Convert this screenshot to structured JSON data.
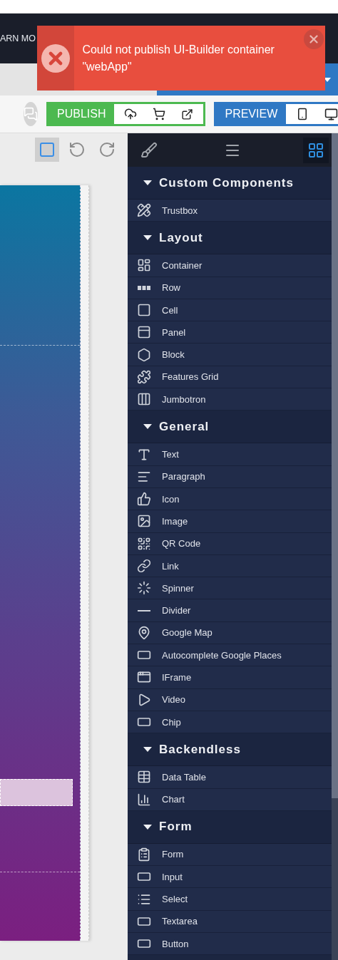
{
  "header": {
    "credits_link": "ARN MO"
  },
  "toast": {
    "message": "Could not publish UI-Builder container \"webApp\""
  },
  "toolbar": {
    "publish": "PUBLISH",
    "preview": "PREVIEW"
  },
  "canvas_tools": [
    {
      "kind": "select",
      "selected": true
    },
    {
      "kind": "undo",
      "selected": false
    },
    {
      "kind": "redo",
      "selected": false
    }
  ],
  "panel_tabs": [
    {
      "kind": "styles",
      "selected": false
    },
    {
      "kind": "layers",
      "selected": false
    },
    {
      "kind": "components",
      "selected": true
    }
  ],
  "sections": [
    {
      "title": "Custom Components",
      "expanded": true,
      "items": [
        {
          "label": "Trustbox"
        }
      ]
    },
    {
      "title": "Layout",
      "expanded": true,
      "items": [
        {
          "label": "Container"
        },
        {
          "label": "Row"
        },
        {
          "label": "Cell"
        },
        {
          "label": "Panel"
        },
        {
          "label": "Block"
        },
        {
          "label": "Features Grid"
        },
        {
          "label": "Jumbotron"
        }
      ]
    },
    {
      "title": "General",
      "expanded": true,
      "items": [
        {
          "label": "Text"
        },
        {
          "label": "Paragraph"
        },
        {
          "label": "Icon"
        },
        {
          "label": "Image"
        },
        {
          "label": "QR Code"
        },
        {
          "label": "Link"
        },
        {
          "label": "Spinner"
        },
        {
          "label": "Divider"
        },
        {
          "label": "Google Map"
        },
        {
          "label": "Autocomplete Google Places"
        },
        {
          "label": "IFrame"
        },
        {
          "label": "Video"
        },
        {
          "label": "Chip"
        }
      ]
    },
    {
      "title": "Backendless",
      "expanded": true,
      "items": [
        {
          "label": "Data Table"
        },
        {
          "label": "Chart"
        }
      ]
    },
    {
      "title": "Form",
      "expanded": true,
      "items": [
        {
          "label": "Form"
        },
        {
          "label": "Input"
        },
        {
          "label": "Select"
        },
        {
          "label": "Textarea"
        },
        {
          "label": "Button"
        }
      ]
    }
  ]
}
